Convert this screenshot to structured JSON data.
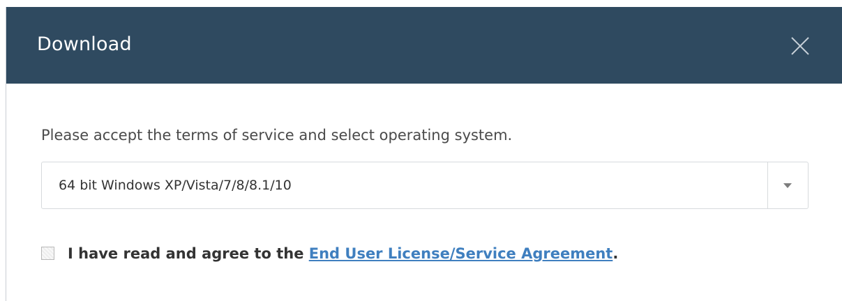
{
  "dialog": {
    "title": "Download",
    "close_icon": "close-icon",
    "prompt": "Please accept the terms of service and select operating system.",
    "os_select": {
      "selected": "64 bit Windows XP/Vista/7/8/8.1/10",
      "arrow_icon": "chevron-down-icon"
    },
    "agreement": {
      "checked": false,
      "text_before": "I have read and agree to the ",
      "link_text": "End User License/Service Agreement",
      "text_after": "."
    }
  },
  "colors": {
    "header_bg": "#2f4a60",
    "link": "#3f7fbf",
    "text": "#4a4a4a"
  }
}
